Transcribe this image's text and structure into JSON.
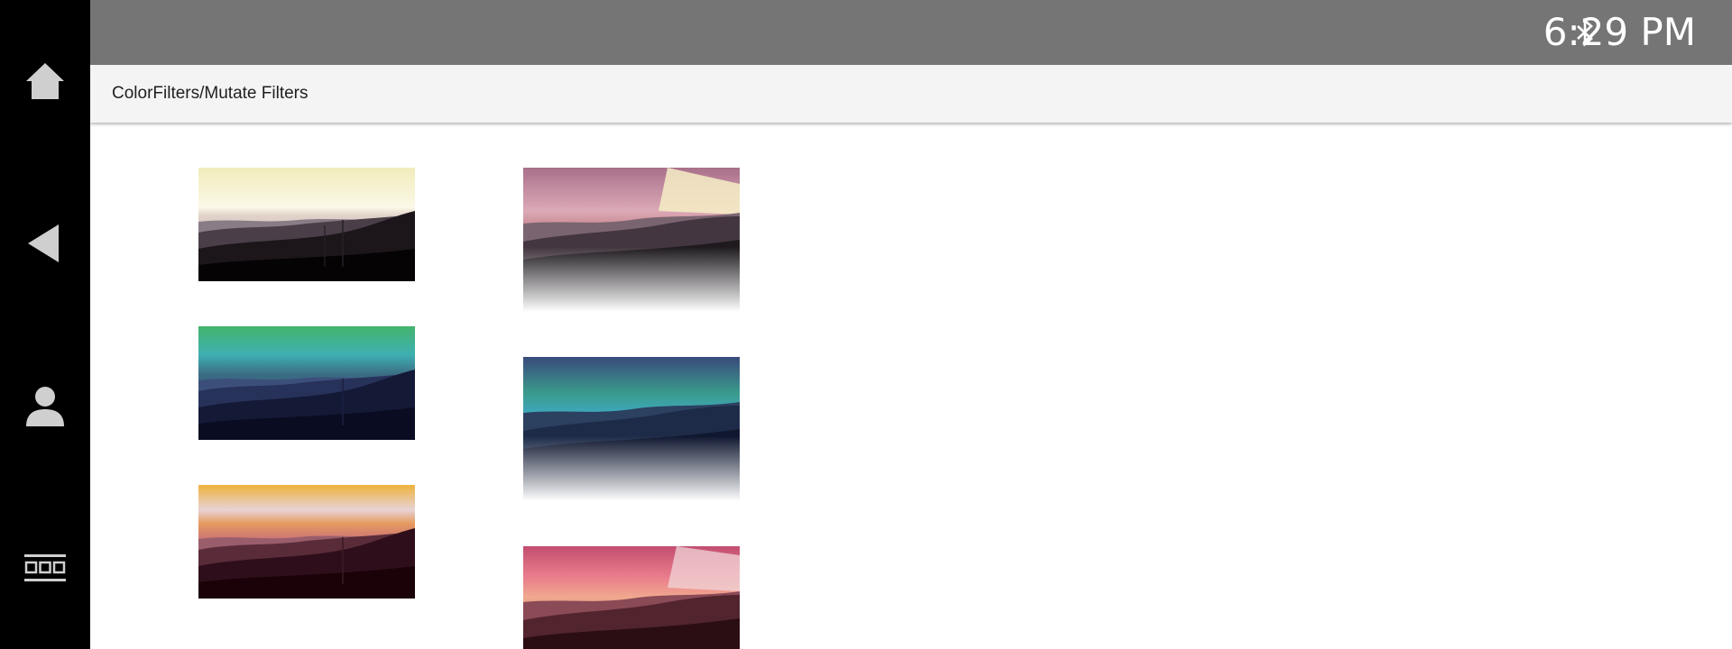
{
  "window": {
    "title": "ColorFilters/Mutate Filters"
  },
  "status_bar": {
    "time": "6:29 PM",
    "bluetooth_icon": "bluetooth-icon"
  },
  "nav": {
    "items": [
      {
        "icon": "home-icon"
      },
      {
        "icon": "back-icon"
      },
      {
        "icon": "person-icon"
      },
      {
        "icon": "apps-grid-icon"
      }
    ]
  },
  "images": [
    {
      "name": "landscape-image-warm",
      "faded": false
    },
    {
      "name": "landscape-image-teal",
      "faded": false
    },
    {
      "name": "landscape-image-sunset",
      "faded": false
    },
    {
      "name": "landscape-image-warm-faded",
      "faded": true
    },
    {
      "name": "landscape-image-teal-faded",
      "faded": true
    },
    {
      "name": "landscape-image-sunset-faded",
      "faded": true
    }
  ],
  "colors": {
    "nav_background": "#000000",
    "status_bar": "#757575",
    "title_bar": "#f4f4f4",
    "content_background": "#ffffff",
    "nav_icon": "#cfcfcf"
  }
}
